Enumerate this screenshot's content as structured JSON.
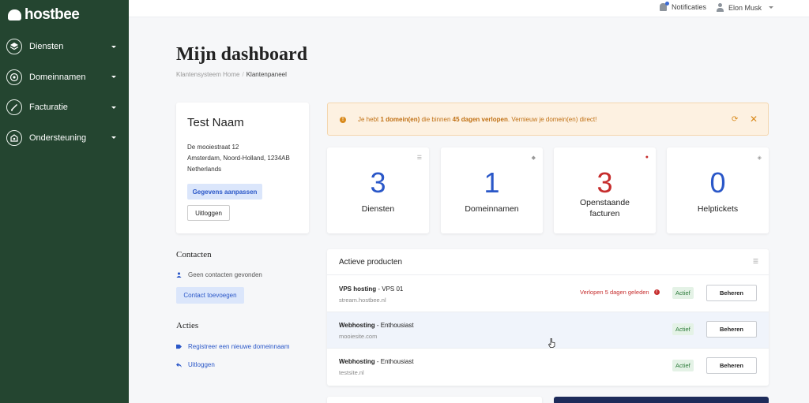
{
  "brand": {
    "logo_text": "hostbee"
  },
  "sidebar": {
    "items": [
      {
        "label": "Diensten",
        "icon": "stack-icon"
      },
      {
        "label": "Domeinnamen",
        "icon": "globe-icon"
      },
      {
        "label": "Facturatie",
        "icon": "invoice-icon"
      },
      {
        "label": "Ondersteuning",
        "icon": "support-icon"
      }
    ]
  },
  "topbar": {
    "notifications_label": "Notificaties",
    "user_name": "Elon Musk"
  },
  "page": {
    "title": "Mijn dashboard",
    "breadcrumb": {
      "home": "Klantensysteem Home",
      "separator": "/",
      "current": "Klantenpaneel"
    }
  },
  "profile": {
    "name": "Test Naam",
    "address_lines": [
      "De mooiestraat 12",
      "Amsterdam, Noord-Holland, 1234AB",
      "Netherlands"
    ],
    "edit_button": "Gegevens aanpassen",
    "logout_button": "Uitloggen"
  },
  "contacts": {
    "title": "Contacten",
    "empty_text": "Geen contacten gevonden",
    "add_button": "Contact toevoegen"
  },
  "actions": {
    "title": "Acties",
    "items": [
      {
        "label": "Registreer een nieuwe domeinnaam",
        "icon": "tag-icon"
      },
      {
        "label": "Uitloggen",
        "icon": "reply-icon"
      }
    ]
  },
  "alert": {
    "prefix": "Je hebt ",
    "count": "1 domein(en)",
    "middle": " die binnen ",
    "days": "45 dagen verlopen",
    "suffix": ". Vernieuw je domein(en) direct!"
  },
  "stats": [
    {
      "value": "3",
      "label": "Diensten",
      "label2": ""
    },
    {
      "value": "1",
      "label": "Domeinnamen",
      "label2": ""
    },
    {
      "value": "3",
      "label": "Openstaande",
      "label2": "facturen"
    },
    {
      "value": "0",
      "label": "Helptickets",
      "label2": ""
    }
  ],
  "products": {
    "title": "Actieve producten",
    "rows": [
      {
        "name": "VPS hosting",
        "plan": " - VPS 01",
        "domain": "stream.hostbee.nl",
        "expired": "Verlopen 5 dagen geleden",
        "status": "Actief",
        "button": "Beheren"
      },
      {
        "name": "Webhosting",
        "plan": " - Enthousiast",
        "domain": "mooiesite.com",
        "expired": "",
        "status": "Actief",
        "button": "Beheren"
      },
      {
        "name": "Webhosting",
        "plan": " - Enthousiast",
        "domain": "testsite.nl",
        "expired": "",
        "status": "Actief",
        "button": "Beheren"
      }
    ]
  },
  "colors": {
    "sidebar": "#244530",
    "accent": "#2a57c8",
    "danger": "#c62d2d",
    "warning": "#d98a1c",
    "success": "#2c7a3a"
  }
}
